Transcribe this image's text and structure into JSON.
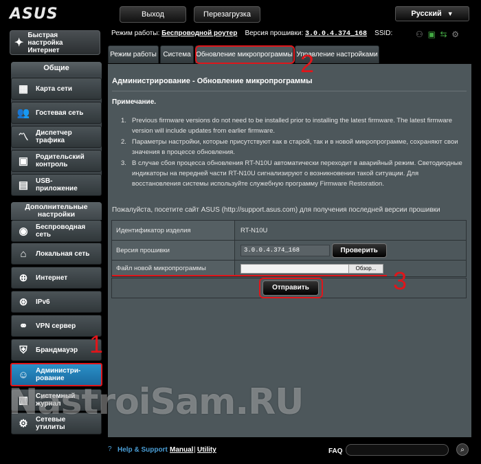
{
  "brand": {
    "logo": "ASUS"
  },
  "topbar": {
    "logout": "Выход",
    "reboot": "Перезагрузка",
    "language": "Русский"
  },
  "sidebar": {
    "quick_setup": "Быстрая настройка Интернет",
    "general_title": "Общие",
    "general_items": [
      {
        "label": "Карта сети",
        "icon": "network-map-icon"
      },
      {
        "label": "Гостевая сеть",
        "icon": "guest-network-icon"
      },
      {
        "label": "Диспетчер трафика",
        "icon": "traffic-manager-icon"
      },
      {
        "label": "Родительский контроль",
        "icon": "parental-control-icon"
      },
      {
        "label": "USB-приложение",
        "icon": "usb-app-icon"
      }
    ],
    "advanced_title": "Дополнительные настройки",
    "advanced_items": [
      {
        "label": "Беспроводная сеть",
        "icon": "wireless-icon"
      },
      {
        "label": "Локальная сеть",
        "icon": "lan-icon"
      },
      {
        "label": "Интернет",
        "icon": "wan-icon"
      },
      {
        "label": "IPv6",
        "icon": "ipv6-icon"
      },
      {
        "label": "VPN сервер",
        "icon": "vpn-icon"
      },
      {
        "label": "Брандмауэр",
        "icon": "firewall-icon"
      },
      {
        "label": "Администри-рование",
        "icon": "admin-icon"
      },
      {
        "label": "Системный журнал",
        "icon": "syslog-icon"
      },
      {
        "label": "Сетевые утилиты",
        "icon": "network-tools-icon"
      }
    ]
  },
  "status": {
    "mode_label": "Режим работы:",
    "mode_value": "Беспроводной роутер",
    "fw_label": "Версия прошивки:",
    "fw_value": "3.0.0.4.374_168",
    "ssid_label": "SSID:"
  },
  "tabs": [
    "Режим работы",
    "Система",
    "Обновление микропрограммы",
    "Управление настройками"
  ],
  "main": {
    "title": "Администрирование - Обновление микропрограммы",
    "note_title": "Примечание.",
    "notes": [
      "Previous firmware versions do not need to be installed prior to installing the latest firmware. The latest firmware version will include updates from earlier firmware.",
      "Параметры настройки, которые присутствуют как в старой, так и в новой микропрограмме, сохраняют свои значения в процессе обновления.",
      "В случае сбоя процесса обновления RT-N10U автоматически переходит в аварийный режим. Светодиодные индикаторы на передней части RT-N10U сигнализируют о возникновении такой ситуации. Для восстановления системы используйте служебную программу Firmware Restoration."
    ],
    "visit_text": "Пожалуйста, посетите сайт ASUS (http://support.asus.com) для получения последней версии прошивки",
    "rows": {
      "product_label": "Идентификатор изделия",
      "product_value": "RT-N10U",
      "fw_label": "Версия прошивки",
      "fw_value": "3.0.0.4.374_168",
      "check_button": "Проверить",
      "file_label": "Файл новой микропрограммы",
      "browse_button": "Обзор..."
    },
    "submit_button": "Отправить"
  },
  "annotations": {
    "n1": "1",
    "n2": "2",
    "n3": "3"
  },
  "footer": {
    "help": "Help & Support",
    "manual": "Manual",
    "sep": "|",
    "utility": "Utility",
    "faq": "FAQ"
  },
  "watermark": "NastroiSam.RU",
  "colors": {
    "accent_red": "#e0151a",
    "active_blue": "#2a90c8",
    "panel_bg": "#4d575b"
  }
}
